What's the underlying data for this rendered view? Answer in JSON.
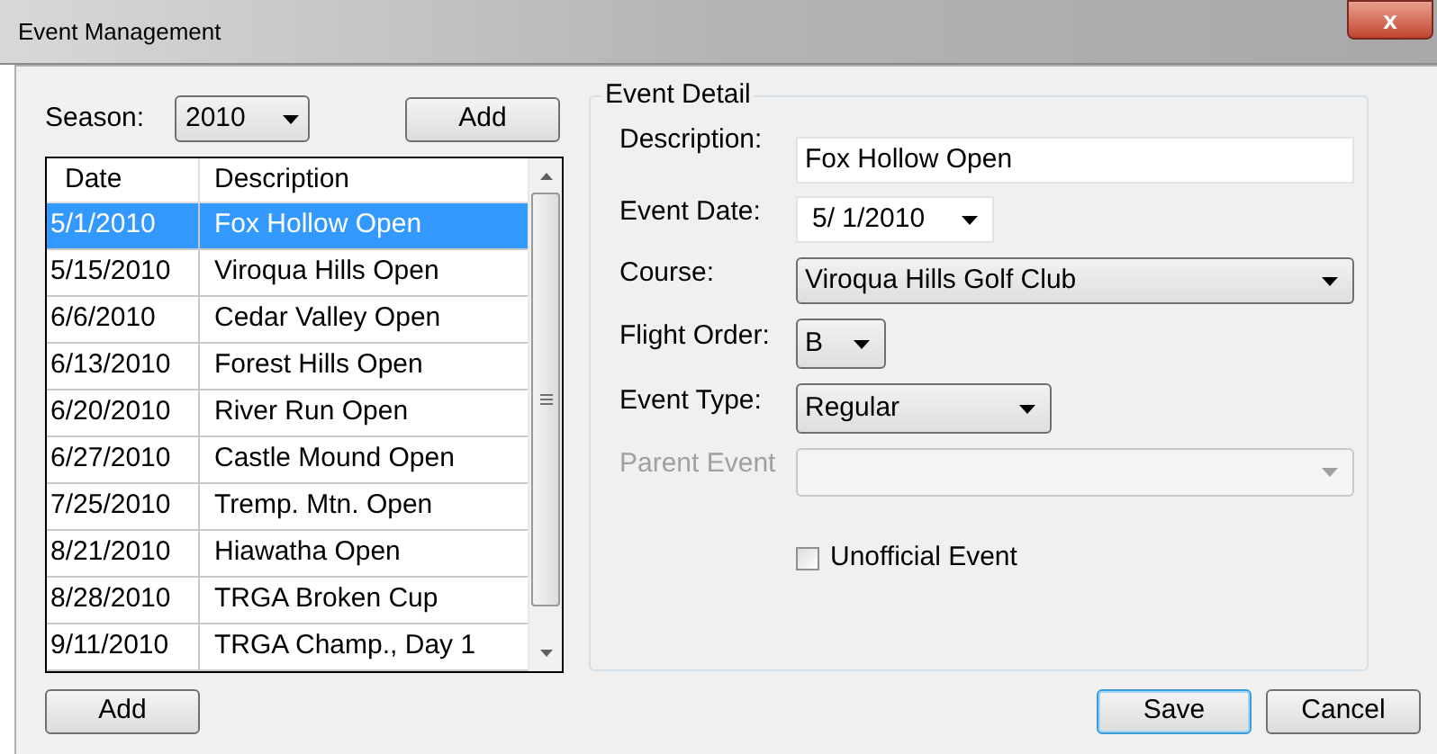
{
  "window": {
    "title": "Event Management",
    "close": "x"
  },
  "season": {
    "label": "Season:",
    "value": "2010"
  },
  "add_top": "Add",
  "table": {
    "columns": [
      "Date",
      "Description"
    ],
    "rows": [
      {
        "date": "5/1/2010",
        "description": "Fox Hollow Open",
        "selected": true
      },
      {
        "date": "5/15/2010",
        "description": "Viroqua Hills Open",
        "selected": false
      },
      {
        "date": "6/6/2010",
        "description": "Cedar Valley Open",
        "selected": false
      },
      {
        "date": "6/13/2010",
        "description": "Forest Hills Open",
        "selected": false
      },
      {
        "date": "6/20/2010",
        "description": "River Run Open",
        "selected": false
      },
      {
        "date": "6/27/2010",
        "description": "Castle Mound Open",
        "selected": false
      },
      {
        "date": "7/25/2010",
        "description": "Tremp. Mtn. Open",
        "selected": false
      },
      {
        "date": "8/21/2010",
        "description": "Hiawatha Open",
        "selected": false
      },
      {
        "date": "8/28/2010",
        "description": "TRGA Broken Cup",
        "selected": false
      },
      {
        "date": "9/11/2010",
        "description": "TRGA Champ., Day 1",
        "selected": false
      }
    ]
  },
  "add_bottom": "Add",
  "event_detail": {
    "title": "Event Detail",
    "fields": [
      {
        "kind": "text",
        "label": "Description:",
        "value": "Fox Hollow Open",
        "disabled": false
      },
      {
        "kind": "date",
        "label": "Event Date:",
        "value": "5/  1/2010",
        "disabled": false
      },
      {
        "kind": "select",
        "label": "Course:",
        "value": "Viroqua Hills Golf Club",
        "disabled": false
      },
      {
        "kind": "select",
        "label": "Flight Order:",
        "value": "B",
        "disabled": false
      },
      {
        "kind": "select",
        "label": "Event Type:",
        "value": "Regular",
        "disabled": false
      },
      {
        "kind": "select",
        "label": "Parent Event",
        "disabled": true
      }
    ],
    "unofficial": {
      "label": "Unofficial Event",
      "checked": false
    }
  },
  "buttons": [
    {
      "label": "Save",
      "default": true
    },
    {
      "label": "Cancel",
      "default": false
    }
  ]
}
